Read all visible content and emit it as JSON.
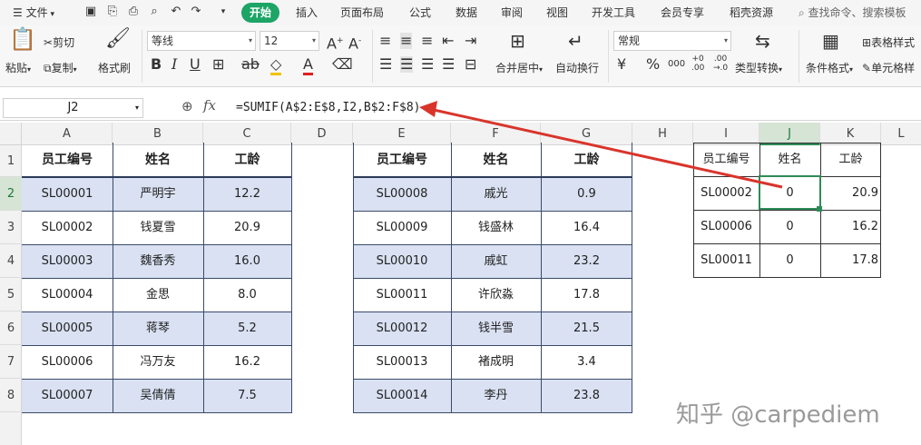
{
  "menubar": {
    "file": "文件",
    "tabs": [
      "开始",
      "插入",
      "页面布局",
      "公式",
      "数据",
      "审阅",
      "视图",
      "开发工具",
      "会员专享",
      "稻壳资源"
    ],
    "active_tab": "开始",
    "search": "查找命令、搜索模板"
  },
  "ribbon": {
    "cut": "剪切",
    "paste": "粘贴",
    "copy": "复制",
    "format_painter": "格式刷",
    "font_name": "等线",
    "font_size": "12",
    "merge_center": "合并居中",
    "wrap_text": "自动换行",
    "number_format": "常规",
    "type_convert": "类型转换",
    "conditional_format": "条件格式",
    "table_style": "表格样式",
    "cell_style": "单元格样"
  },
  "formula_bar": {
    "name_box": "J2",
    "fx": "fx",
    "formula": "=SUMIF(A$2:E$8,I2,B$2:F$8)"
  },
  "grid": {
    "columns": [
      "A",
      "B",
      "C",
      "D",
      "E",
      "F",
      "G",
      "H",
      "I",
      "J",
      "K",
      "L"
    ],
    "rows": [
      "1",
      "2",
      "3",
      "4",
      "5",
      "6",
      "7",
      "8"
    ],
    "selected_col": "J",
    "selected_row": "2"
  },
  "table1": {
    "headers": [
      "员工编号",
      "姓名",
      "工龄"
    ],
    "rows": [
      [
        "SL00001",
        "严明宇",
        "12.2"
      ],
      [
        "SL00002",
        "钱夏雪",
        "20.9"
      ],
      [
        "SL00003",
        "魏香秀",
        "16.0"
      ],
      [
        "SL00004",
        "金思",
        "8.0"
      ],
      [
        "SL00005",
        "蒋琴",
        "5.2"
      ],
      [
        "SL00006",
        "冯万友",
        "16.2"
      ],
      [
        "SL00007",
        "吴倩倩",
        "7.5"
      ]
    ]
  },
  "table2": {
    "headers": [
      "员工编号",
      "姓名",
      "工龄"
    ],
    "rows": [
      [
        "SL00008",
        "戚光",
        "0.9"
      ],
      [
        "SL00009",
        "钱盛林",
        "16.4"
      ],
      [
        "SL00010",
        "戚虹",
        "23.2"
      ],
      [
        "SL00011",
        "许欣淼",
        "17.8"
      ],
      [
        "SL00012",
        "钱半雪",
        "21.5"
      ],
      [
        "SL00013",
        "褚成明",
        "3.4"
      ],
      [
        "SL00014",
        "李丹",
        "23.8"
      ]
    ]
  },
  "table3": {
    "headers": [
      "员工编号",
      "姓名",
      "工龄"
    ],
    "rows": [
      [
        "SL00002",
        "0",
        "20.9"
      ],
      [
        "SL00006",
        "0",
        "16.2"
      ],
      [
        "SL00011",
        "0",
        "17.8"
      ]
    ]
  },
  "watermark": "知乎 @carpediem",
  "colors": {
    "accent": "#1da467",
    "band": "#d9e1f2",
    "selection": "#2e8b57",
    "arrow": "#d9342b"
  }
}
